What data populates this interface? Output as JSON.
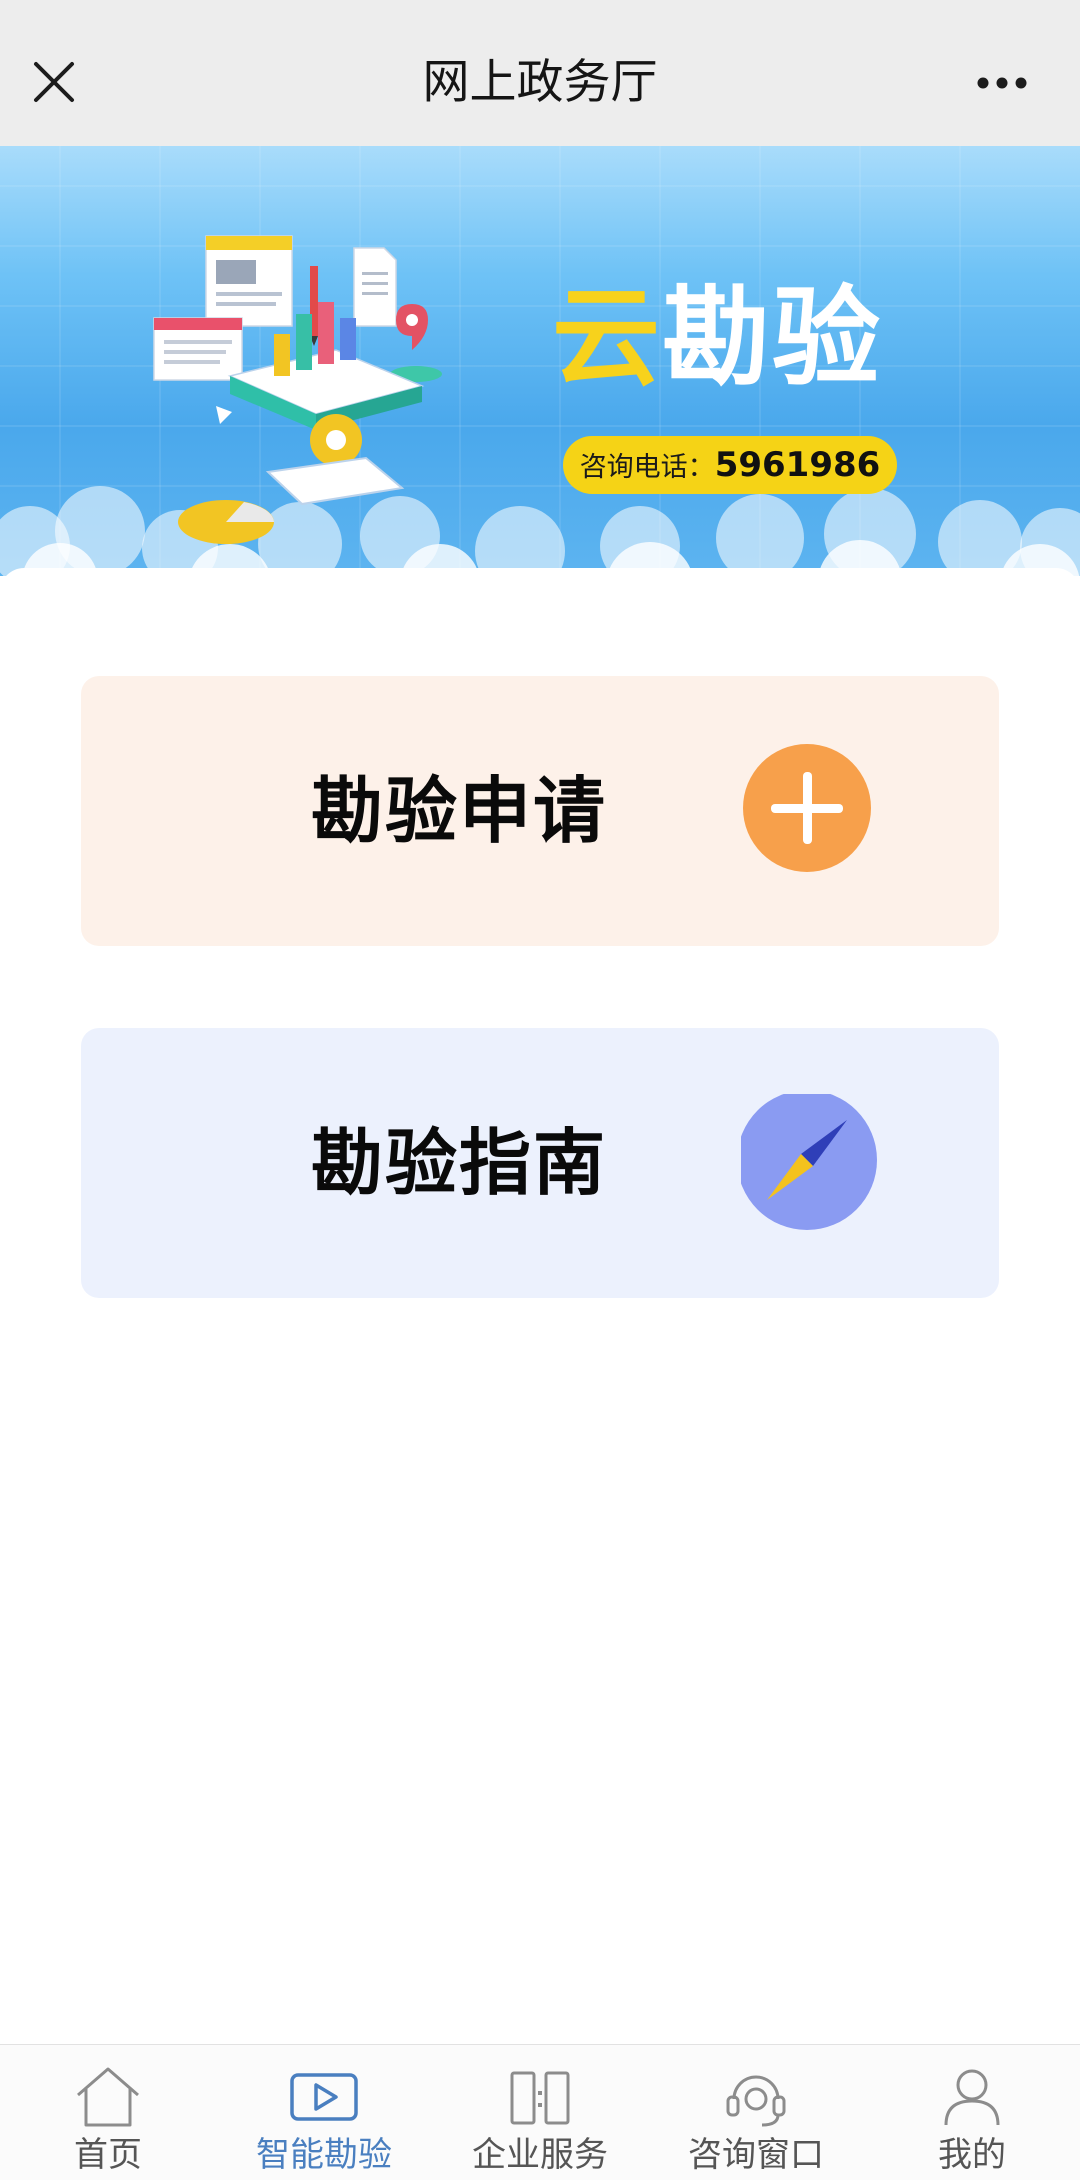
{
  "header": {
    "title": "网上政务厅",
    "close_icon": "close-icon",
    "more_icon": "more-icon"
  },
  "banner": {
    "brand_highlight": "云",
    "brand_rest": "勘验",
    "phone_label": "咨询电话：",
    "phone_number": "5961986"
  },
  "cards": {
    "apply": {
      "label": "勘验申请",
      "icon": "plus-icon",
      "color": "#f7a04b",
      "bg": "#fdf1e9"
    },
    "guide": {
      "label": "勘验指南",
      "icon": "compass-icon",
      "color": "#8a9bf2",
      "bg": "#ecf1fd"
    }
  },
  "tabs": [
    {
      "label": "首页",
      "icon": "home-icon",
      "active": false
    },
    {
      "label": "智能勘验",
      "icon": "video-icon",
      "active": true
    },
    {
      "label": "企业服务",
      "icon": "building-icon",
      "active": false
    },
    {
      "label": "咨询窗口",
      "icon": "headset-icon",
      "active": false
    },
    {
      "label": "我的",
      "icon": "user-icon",
      "active": false
    }
  ],
  "colors": {
    "active_tab": "#4a7fc0",
    "inactive_tab": "#555555",
    "brand_yellow": "#f7d21c"
  }
}
